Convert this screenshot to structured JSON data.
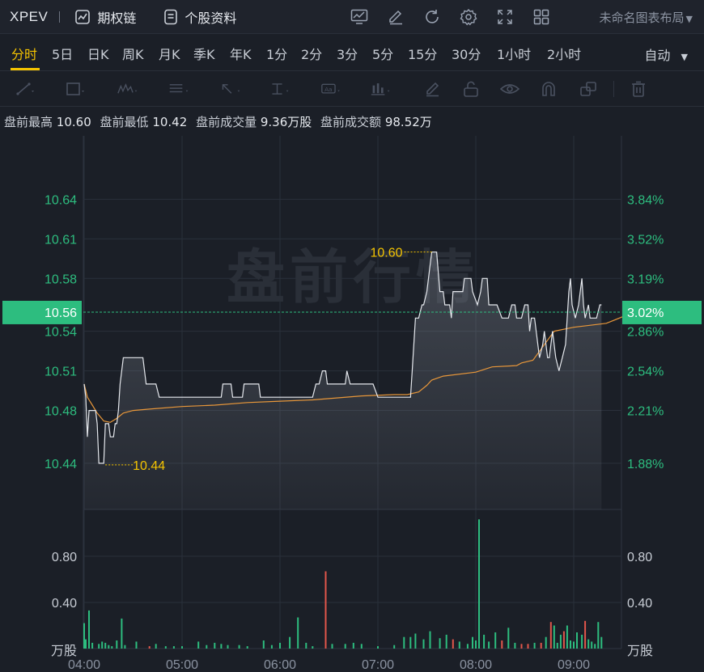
{
  "header": {
    "symbol": "XPEV",
    "options_chain": "期权链",
    "profile": "个股资料",
    "layout_name": "未命名图表布局"
  },
  "periods": [
    "分时",
    "5日",
    "日K",
    "周K",
    "月K",
    "季K",
    "年K",
    "1分",
    "2分",
    "3分",
    "5分",
    "15分",
    "30分",
    "1小时",
    "2小时"
  ],
  "active_period": "分时",
  "mode_select": "自动",
  "info": {
    "high_label": "盘前最高",
    "high": "10.60",
    "low_label": "盘前最低",
    "low": "10.42",
    "vol_label": "盘前成交量",
    "vol": "9.36万股",
    "amt_label": "盘前成交额",
    "amt": "98.52万"
  },
  "watermark": "盘前行情",
  "colors": {
    "up": "#2dbd7f",
    "down": "#e2564b",
    "accent": "#f5c400",
    "avg_line": "#e8973a",
    "price_line": "#e6e9ee",
    "current_badge": "#2dbd7f"
  },
  "chart_data": {
    "type": "line",
    "price_ylim": [
      10.405,
      10.688
    ],
    "price_ticks": [
      "10.64",
      "10.61",
      "10.58",
      "10.54",
      "10.51",
      "10.48",
      "10.44"
    ],
    "pct_ticks": [
      "3.84%",
      "3.52%",
      "3.19%",
      "2.86%",
      "2.54%",
      "2.21%",
      "1.88%"
    ],
    "current_price": "10.56",
    "current_pct": "3.02%",
    "high_marker": "10.60",
    "low_marker": "10.44",
    "x_ticks": [
      "04:00",
      "05:00",
      "06:00",
      "07:00",
      "08:00",
      "09:00"
    ],
    "x_range_minutes": [
      0,
      330
    ],
    "price_series": [
      [
        0,
        10.5
      ],
      [
        1,
        10.49
      ],
      [
        2,
        10.46
      ],
      [
        3,
        10.48
      ],
      [
        5,
        10.48
      ],
      [
        7,
        10.48
      ],
      [
        8,
        10.47
      ],
      [
        9,
        10.44
      ],
      [
        10,
        10.44
      ],
      [
        12,
        10.44
      ],
      [
        13,
        10.47
      ],
      [
        15,
        10.47
      ],
      [
        16,
        10.46
      ],
      [
        18,
        10.46
      ],
      [
        19,
        10.47
      ],
      [
        20,
        10.47
      ],
      [
        21,
        10.48
      ],
      [
        22,
        10.5
      ],
      [
        24,
        10.52
      ],
      [
        26,
        10.52
      ],
      [
        30,
        10.52
      ],
      [
        36,
        10.52
      ],
      [
        37,
        10.51
      ],
      [
        38,
        10.5
      ],
      [
        44,
        10.5
      ],
      [
        46,
        10.49
      ],
      [
        50,
        10.49
      ],
      [
        60,
        10.49
      ],
      [
        70,
        10.49
      ],
      [
        80,
        10.49
      ],
      [
        84,
        10.49
      ],
      [
        85,
        10.5
      ],
      [
        90,
        10.5
      ],
      [
        91,
        10.49
      ],
      [
        97,
        10.49
      ],
      [
        98,
        10.5
      ],
      [
        107,
        10.5
      ],
      [
        108,
        10.49
      ],
      [
        128,
        10.49
      ],
      [
        140,
        10.49
      ],
      [
        142,
        10.5
      ],
      [
        144,
        10.5
      ],
      [
        146,
        10.51
      ],
      [
        148,
        10.51
      ],
      [
        149,
        10.5
      ],
      [
        160,
        10.5
      ],
      [
        161,
        10.51
      ],
      [
        163,
        10.5
      ],
      [
        165,
        10.5
      ],
      [
        170,
        10.5
      ],
      [
        177,
        10.5
      ],
      [
        180,
        10.49
      ],
      [
        200,
        10.49
      ],
      [
        201,
        10.51
      ],
      [
        203,
        10.55
      ],
      [
        205,
        10.55
      ],
      [
        207,
        10.56
      ],
      [
        208,
        10.56
      ],
      [
        210,
        10.57
      ],
      [
        213,
        10.6
      ],
      [
        216,
        10.6
      ],
      [
        218,
        10.57
      ],
      [
        220,
        10.57
      ],
      [
        221,
        10.56
      ],
      [
        224,
        10.56
      ],
      [
        225,
        10.55
      ],
      [
        226,
        10.57
      ],
      [
        230,
        10.57
      ],
      [
        232,
        10.57
      ],
      [
        233,
        10.58
      ],
      [
        237,
        10.58
      ],
      [
        238,
        10.57
      ],
      [
        241,
        10.56
      ],
      [
        243,
        10.57
      ],
      [
        244,
        10.58
      ],
      [
        247,
        10.58
      ],
      [
        248,
        10.56
      ],
      [
        253,
        10.56
      ],
      [
        256,
        10.55
      ],
      [
        258,
        10.55
      ],
      [
        260,
        10.55
      ],
      [
        262,
        10.56
      ],
      [
        264,
        10.56
      ],
      [
        265,
        10.55
      ],
      [
        268,
        10.55
      ],
      [
        270,
        10.56
      ],
      [
        272,
        10.56
      ],
      [
        273,
        10.54
      ],
      [
        274,
        10.55
      ],
      [
        276,
        10.55
      ],
      [
        279,
        10.52
      ],
      [
        281,
        10.53
      ],
      [
        282,
        10.54
      ],
      [
        284,
        10.52
      ],
      [
        285,
        10.52
      ],
      [
        287,
        10.54
      ],
      [
        289,
        10.52
      ],
      [
        291,
        10.51
      ],
      [
        293,
        10.52
      ],
      [
        295,
        10.53
      ],
      [
        297,
        10.57
      ],
      [
        298,
        10.58
      ],
      [
        299,
        10.56
      ],
      [
        301,
        10.55
      ],
      [
        303,
        10.56
      ],
      [
        305,
        10.58
      ],
      [
        306,
        10.56
      ],
      [
        307,
        10.55
      ],
      [
        309,
        10.56
      ],
      [
        310,
        10.55
      ],
      [
        312,
        10.55
      ],
      [
        314,
        10.55
      ],
      [
        316,
        10.56
      ],
      [
        317,
        10.56
      ]
    ],
    "avg_series": [
      [
        0,
        10.5
      ],
      [
        2,
        10.49
      ],
      [
        5,
        10.484
      ],
      [
        8,
        10.478
      ],
      [
        12,
        10.472
      ],
      [
        16,
        10.471
      ],
      [
        20,
        10.474
      ],
      [
        24,
        10.478
      ],
      [
        30,
        10.48
      ],
      [
        40,
        10.481
      ],
      [
        60,
        10.483
      ],
      [
        80,
        10.484
      ],
      [
        100,
        10.486
      ],
      [
        120,
        10.487
      ],
      [
        140,
        10.488
      ],
      [
        150,
        10.489
      ],
      [
        170,
        10.491
      ],
      [
        190,
        10.492
      ],
      [
        198,
        10.492
      ],
      [
        205,
        10.494
      ],
      [
        210,
        10.499
      ],
      [
        213,
        10.503
      ],
      [
        220,
        10.506
      ],
      [
        240,
        10.509
      ],
      [
        250,
        10.513
      ],
      [
        265,
        10.514
      ],
      [
        268,
        10.516
      ],
      [
        275,
        10.518
      ],
      [
        285,
        10.535
      ],
      [
        288,
        10.54
      ],
      [
        296,
        10.542
      ],
      [
        300,
        10.543
      ],
      [
        320,
        10.546
      ],
      [
        330,
        10.551
      ]
    ],
    "volume_ylim": [
      0,
      1.15
    ],
    "volume_ticks": [
      "0.80",
      "0.40"
    ],
    "volume_unit": "万股",
    "volume_bars": [
      [
        0,
        0.22,
        "up"
      ],
      [
        1,
        0.08,
        "up"
      ],
      [
        3,
        0.33,
        "up"
      ],
      [
        5,
        0.05,
        "up"
      ],
      [
        9,
        0.04,
        "up"
      ],
      [
        11,
        0.06,
        "up"
      ],
      [
        13,
        0.05,
        "up"
      ],
      [
        15,
        0.03,
        "up"
      ],
      [
        17,
        0.02,
        "up"
      ],
      [
        20,
        0.07,
        "up"
      ],
      [
        23,
        0.26,
        "up"
      ],
      [
        25,
        0.03,
        "up"
      ],
      [
        32,
        0.06,
        "up"
      ],
      [
        40,
        0.02,
        "down"
      ],
      [
        44,
        0.04,
        "up"
      ],
      [
        50,
        0.02,
        "up"
      ],
      [
        55,
        0.02,
        "up"
      ],
      [
        60,
        0.02,
        "up"
      ],
      [
        70,
        0.06,
        "up"
      ],
      [
        75,
        0.03,
        "up"
      ],
      [
        80,
        0.05,
        "up"
      ],
      [
        84,
        0.04,
        "up"
      ],
      [
        88,
        0.03,
        "up"
      ],
      [
        95,
        0.03,
        "up"
      ],
      [
        100,
        0.02,
        "up"
      ],
      [
        110,
        0.07,
        "up"
      ],
      [
        115,
        0.03,
        "up"
      ],
      [
        120,
        0.05,
        "up"
      ],
      [
        126,
        0.1,
        "up"
      ],
      [
        131,
        0.27,
        "up"
      ],
      [
        136,
        0.05,
        "up"
      ],
      [
        140,
        0.02,
        "up"
      ],
      [
        148,
        0.67,
        "down"
      ],
      [
        152,
        0.04,
        "up"
      ],
      [
        160,
        0.04,
        "up"
      ],
      [
        165,
        0.05,
        "up"
      ],
      [
        170,
        0.04,
        "up"
      ],
      [
        180,
        0.02,
        "up"
      ],
      [
        190,
        0.03,
        "up"
      ],
      [
        196,
        0.1,
        "up"
      ],
      [
        200,
        0.1,
        "up"
      ],
      [
        203,
        0.13,
        "up"
      ],
      [
        208,
        0.08,
        "up"
      ],
      [
        212,
        0.15,
        "up"
      ],
      [
        218,
        0.09,
        "up"
      ],
      [
        222,
        0.12,
        "up"
      ],
      [
        226,
        0.08,
        "down"
      ],
      [
        230,
        0.06,
        "up"
      ],
      [
        235,
        0.04,
        "up"
      ],
      [
        238,
        0.1,
        "up"
      ],
      [
        240,
        0.07,
        "up"
      ],
      [
        242,
        1.12,
        "up"
      ],
      [
        245,
        0.12,
        "up"
      ],
      [
        248,
        0.06,
        "up"
      ],
      [
        252,
        0.14,
        "up"
      ],
      [
        256,
        0.07,
        "down"
      ],
      [
        260,
        0.18,
        "up"
      ],
      [
        264,
        0.05,
        "up"
      ],
      [
        268,
        0.04,
        "down"
      ],
      [
        272,
        0.04,
        "down"
      ],
      [
        276,
        0.05,
        "up"
      ],
      [
        280,
        0.05,
        "down"
      ],
      [
        283,
        0.1,
        "up"
      ],
      [
        286,
        0.23,
        "down"
      ],
      [
        288,
        0.2,
        "up"
      ],
      [
        290,
        0.05,
        "up"
      ],
      [
        292,
        0.12,
        "up"
      ],
      [
        294,
        0.15,
        "down"
      ],
      [
        296,
        0.2,
        "up"
      ],
      [
        298,
        0.07,
        "up"
      ],
      [
        300,
        0.06,
        "up"
      ],
      [
        302,
        0.14,
        "up"
      ],
      [
        305,
        0.12,
        "up"
      ],
      [
        307,
        0.24,
        "down"
      ],
      [
        309,
        0.08,
        "up"
      ],
      [
        311,
        0.06,
        "up"
      ],
      [
        313,
        0.04,
        "up"
      ],
      [
        315,
        0.23,
        "up"
      ],
      [
        317,
        0.1,
        "up"
      ]
    ]
  }
}
